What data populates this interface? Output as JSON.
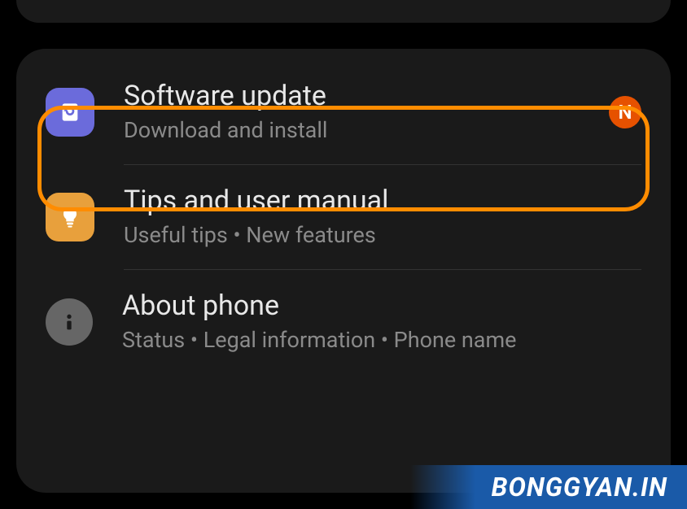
{
  "settings": {
    "items": [
      {
        "title": "Software update",
        "subtitle": "Download and install",
        "icon": "update-icon",
        "iconColor": "#6b6bdb",
        "badge": "N"
      },
      {
        "title": "Tips and user manual",
        "subtitle": "Useful tips  •  New features",
        "icon": "lightbulb-icon",
        "iconColor": "#e8a03c"
      },
      {
        "title": "About phone",
        "subtitle": "Status  •  Legal information  •  Phone name",
        "icon": "info-icon",
        "iconColor": "#666666"
      }
    ]
  },
  "watermark": "BONGGYAN.IN"
}
